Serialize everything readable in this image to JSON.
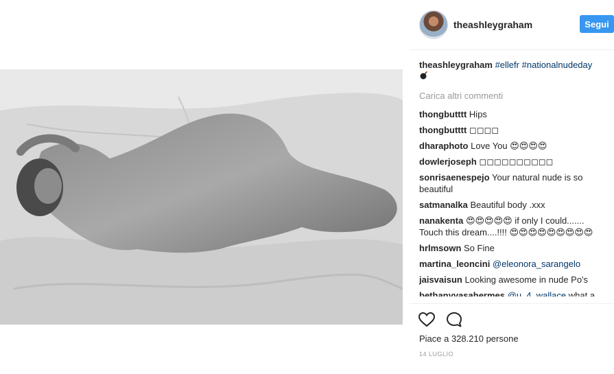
{
  "header": {
    "username": "theashleygraham",
    "follow_label": "Segui"
  },
  "caption": {
    "username": "theashleygraham",
    "tags": [
      "#ellefr",
      "#nationalnudeday"
    ],
    "icon": "bomb-icon"
  },
  "load_more_label": "Carica altri commenti",
  "comments": [
    {
      "user": "thongbutttt",
      "text": "Hips"
    },
    {
      "user": "thongbutttt",
      "text": "◻◻◻◻"
    },
    {
      "user": "dharaphoto",
      "text": "Love You 😍😍😍😍"
    },
    {
      "user": "dowlerjoseph",
      "text": "◻◻◻◻◻◻◻◻◻◻"
    },
    {
      "user": "sonrisaenespejo",
      "text": "Your natural nude is so beautiful"
    },
    {
      "user": "satmanalka",
      "text": "Beautiful body .xxx"
    },
    {
      "user": "nanakenta",
      "text": "😍😍😍😍😍 if only I could....... Touch this dream....!!!! 😍😍😍😍😍😍😍😍😍"
    },
    {
      "user": "hrlmsown",
      "text": "So Fine"
    },
    {
      "user": "martina_leoncini",
      "mention": "@eleonora_sarangelo"
    },
    {
      "user": "jaisvaisun",
      "text": "Looking awesome in nude Po's"
    },
    {
      "user": "bethanyvasahermes",
      "mention": "@u_4_wallace",
      "text": "what a"
    }
  ],
  "actions": {
    "like_icon": "heart-icon",
    "comment_icon": "comment-icon"
  },
  "likes": "Piace a 328.210 persone",
  "date": "14 LUGLIO"
}
